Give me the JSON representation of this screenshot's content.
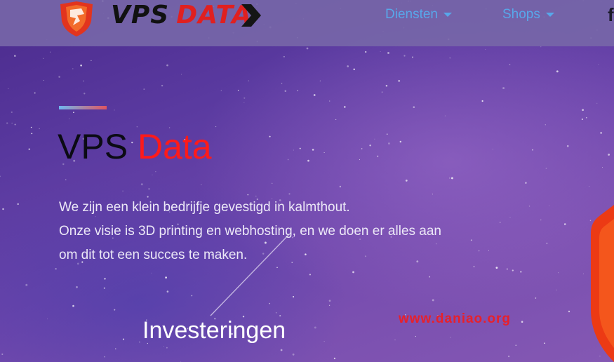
{
  "header": {
    "logo": {
      "word1": "VPS",
      "word2": "DATA"
    },
    "nav": [
      {
        "label": "Diensten",
        "icon": "chevron-down-icon"
      },
      {
        "label": "Shops",
        "icon": "chevron-down-icon"
      }
    ],
    "social_icon": "facebook-icon",
    "social_glyph": "f"
  },
  "hero": {
    "title_part1": "VPS",
    "title_part2": "Data",
    "paragraph_lines": [
      "We zijn een klein bedrijfje gevestigd in kalmthout.",
      "Onze visie is 3D printing en webhosting, en we doen er alles aan",
      "om dit tot een succes te maken."
    ]
  },
  "section": {
    "heading": "Investeringen"
  },
  "watermark": "www.daniao.org",
  "colors": {
    "nav_text": "#58a7ea",
    "brand_red": "#e02020",
    "title_red": "#ff1a1a",
    "header_bg": "#7666a8",
    "accent_blue": "#6fb7ef",
    "accent_red": "#e05560"
  }
}
